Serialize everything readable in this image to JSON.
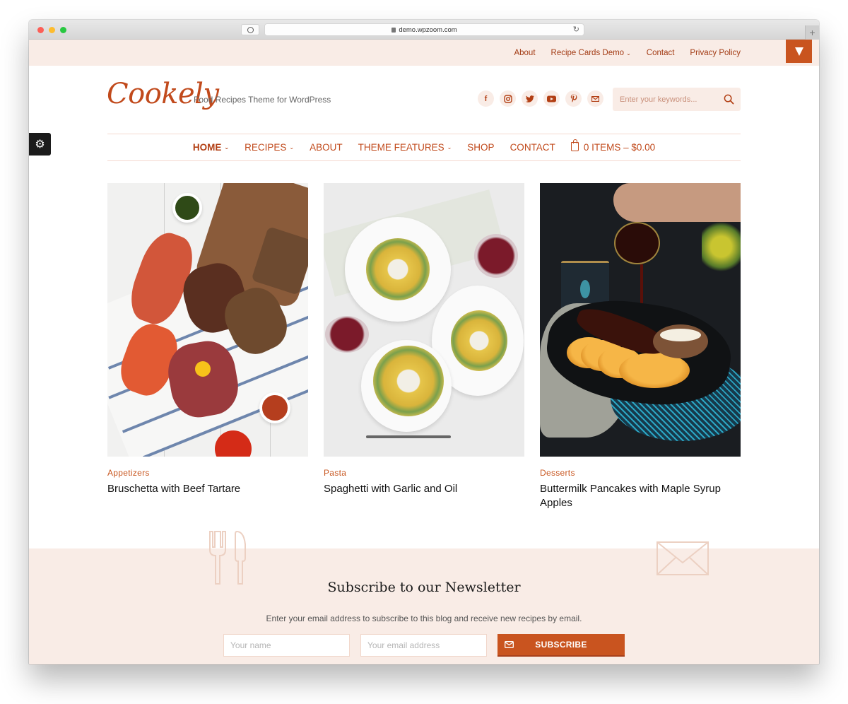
{
  "browser": {
    "url": "demo.wpzoom.com",
    "new_tab_symbol": "+"
  },
  "topbar": {
    "links": [
      {
        "label": "About",
        "has_dropdown": false
      },
      {
        "label": "Recipe Cards Demo",
        "has_dropdown": true
      },
      {
        "label": "Contact",
        "has_dropdown": false
      },
      {
        "label": "Privacy Policy",
        "has_dropdown": false
      }
    ],
    "caret": "⌄"
  },
  "header": {
    "logo": "Cookely",
    "tagline": "Food Recipes Theme for WordPress",
    "socials": [
      {
        "icon": "facebook-icon",
        "glyph": "f"
      },
      {
        "icon": "instagram-icon",
        "glyph": "◎"
      },
      {
        "icon": "twitter-icon",
        "glyph": "🐦"
      },
      {
        "icon": "youtube-icon",
        "glyph": "▶"
      },
      {
        "icon": "pinterest-icon",
        "glyph": "P"
      },
      {
        "icon": "email-icon",
        "glyph": "✉"
      }
    ],
    "search_placeholder": "Enter your keywords..."
  },
  "nav": {
    "items": [
      {
        "label": "Home",
        "has_dropdown": true,
        "active": true
      },
      {
        "label": "Recipes",
        "has_dropdown": true,
        "active": false
      },
      {
        "label": "About",
        "has_dropdown": false,
        "active": false
      },
      {
        "label": "Theme Features",
        "has_dropdown": true,
        "active": false
      },
      {
        "label": "Shop",
        "has_dropdown": false,
        "active": false
      },
      {
        "label": "Contact",
        "has_dropdown": false,
        "active": false
      }
    ],
    "cart_label": "0 ITEMS – $0.00",
    "caret": "⌄"
  },
  "settings_tab": {
    "glyph": "⚙"
  },
  "recipes": [
    {
      "category": "Appetizers",
      "title": "Bruschetta with Beef Tartare"
    },
    {
      "category": "Pasta",
      "title": "Spaghetti with Garlic and Oil"
    },
    {
      "category": "Desserts",
      "title": "Buttermilk Pancakes with Maple Syrup Apples"
    }
  ],
  "newsletter": {
    "title": "Subscribe to our Newsletter",
    "subtitle": "Enter your email address to subscribe to this blog and receive new recipes by email.",
    "name_placeholder": "Your name",
    "email_placeholder": "Your email address",
    "button_label": "SUBSCRIBE"
  },
  "colors": {
    "accent": "#c9541f",
    "accent_dark": "#a33c15",
    "tint_bg": "#f9ece6"
  }
}
